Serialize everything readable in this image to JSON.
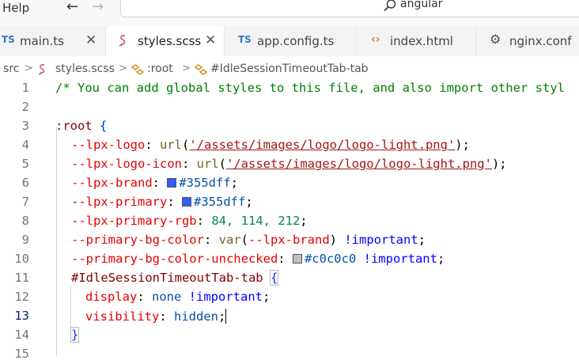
{
  "menu": {
    "help_label": "Help"
  },
  "nav": {
    "back_glyph": "←",
    "forward_glyph": "→"
  },
  "search": {
    "text": "angular"
  },
  "tabs": [
    {
      "icon": "TS",
      "label": "main.ts",
      "close": "✕",
      "icon_color": "#3178c6"
    },
    {
      "icon": "ꝭ",
      "label": "styles.scss",
      "close": "✕",
      "icon_color": "#c6538c"
    },
    {
      "icon": "TS",
      "label": "app.config.ts",
      "icon_color": "#3178c6"
    },
    {
      "icon": "‹›",
      "label": "index.html",
      "icon_color": "#e37933"
    },
    {
      "icon": "⚙",
      "label": "nginx.conf",
      "icon_color": "#555555"
    }
  ],
  "breadcrumb": {
    "root": "src",
    "file": "styles.scss",
    "selector1": ":root",
    "selector2": "#IdleSessionTimeoutTab-tab",
    "sep": ">"
  },
  "editor": {
    "line_numbers": [
      "1",
      "2",
      "3",
      "4",
      "5",
      "6",
      "7",
      "8",
      "9",
      "10",
      "11",
      "12",
      "13",
      "14",
      "15"
    ],
    "lines": {
      "l1": "/* You can add global styles to this file, and also import other styl",
      "l3_sel": ":root",
      "l3_brace": "{",
      "l4_prop": "--lpx-logo",
      "l4_fn": "url",
      "l4_str": "'/assets/images/logo/logo-light.png'",
      "l5_prop": "--lpx-logo-icon",
      "l5_fn": "url",
      "l5_str": "'/assets/images/logo/logo-light.png'",
      "l6_prop": "--lpx-brand",
      "l6_val": "#355dff",
      "l7_prop": "--lpx-primary",
      "l7_val": "#355dff",
      "l8_prop": "--lpx-primary-rgb",
      "l8_val": "84, 114, 212",
      "l9_prop": "--primary-bg-color",
      "l9_fn": "var",
      "l9_arg": "--lpx-brand",
      "l9_imp": "!important",
      "l10_prop": "--primary-bg-color-unchecked",
      "l10_val": "#c0c0c0",
      "l10_imp": "!important",
      "l11_sel": "#IdleSessionTimeoutTab-tab",
      "l11_brace": "{",
      "l12_prop": "display",
      "l12_val": "none",
      "l12_imp": "!important",
      "l13_prop": "visibility",
      "l13_val": "hidden",
      "l14_brace": "}"
    },
    "swatch_colors": {
      "brand": "#355dff",
      "primary": "#355dff",
      "unchecked": "#c0c0c0"
    }
  }
}
